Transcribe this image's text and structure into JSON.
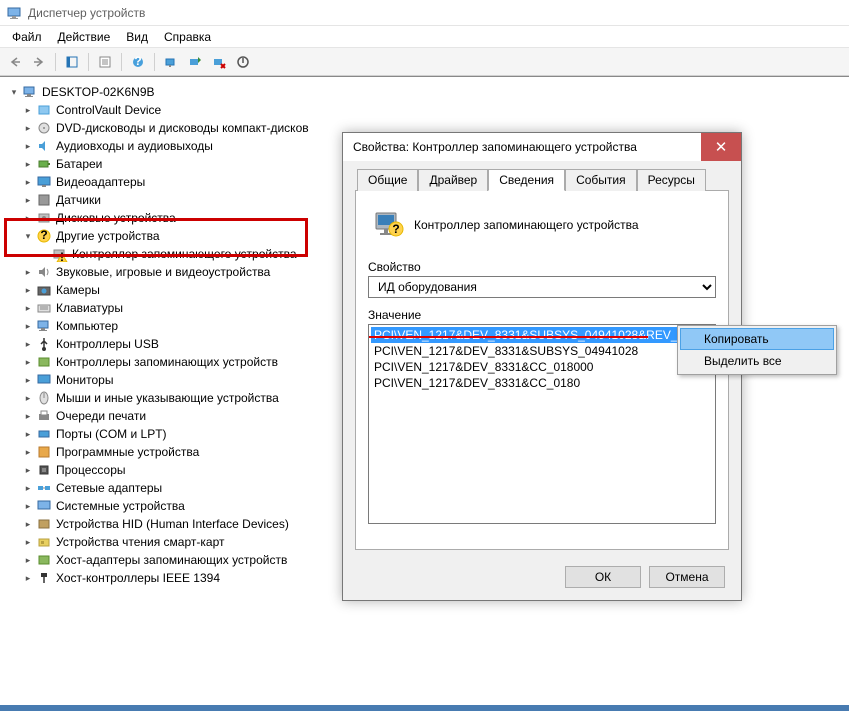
{
  "window": {
    "title": "Диспетчер устройств"
  },
  "menu": {
    "file": "Файл",
    "action": "Действие",
    "view": "Вид",
    "help": "Справка"
  },
  "tree": {
    "root": "DESKTOP-02K6N9B",
    "nodes": [
      {
        "label": "ControlVault Device",
        "icon": "device"
      },
      {
        "label": "DVD-дисководы и дисководы компакт-дисков",
        "icon": "disc"
      },
      {
        "label": "Аудиовходы и аудиовыходы",
        "icon": "audio"
      },
      {
        "label": "Батареи",
        "icon": "battery"
      },
      {
        "label": "Видеоадаптеры",
        "icon": "display"
      },
      {
        "label": "Датчики",
        "icon": "sensor"
      },
      {
        "label": "Дисковые устройства",
        "icon": "disk"
      },
      {
        "label": "Другие устройства",
        "icon": "unknown",
        "expanded": true,
        "children": [
          {
            "label": "Контроллер запоминающего устройства",
            "icon": "warning"
          }
        ]
      },
      {
        "label": "Звуковые, игровые и видеоустройства",
        "icon": "sound"
      },
      {
        "label": "Камеры",
        "icon": "camera"
      },
      {
        "label": "Клавиатуры",
        "icon": "keyboard"
      },
      {
        "label": "Компьютер",
        "icon": "computer"
      },
      {
        "label": "Контроллеры USB",
        "icon": "usb"
      },
      {
        "label": "Контроллеры запоминающих устройств",
        "icon": "storage"
      },
      {
        "label": "Мониторы",
        "icon": "monitor"
      },
      {
        "label": "Мыши и иные указывающие устройства",
        "icon": "mouse"
      },
      {
        "label": "Очереди печати",
        "icon": "printer"
      },
      {
        "label": "Порты (COM и LPT)",
        "icon": "port"
      },
      {
        "label": "Программные устройства",
        "icon": "software"
      },
      {
        "label": "Процессоры",
        "icon": "cpu"
      },
      {
        "label": "Сетевые адаптеры",
        "icon": "network"
      },
      {
        "label": "Системные устройства",
        "icon": "system"
      },
      {
        "label": "Устройства HID (Human Interface Devices)",
        "icon": "hid"
      },
      {
        "label": "Устройства чтения смарт-карт",
        "icon": "smartcard"
      },
      {
        "label": "Хост-адаптеры запоминающих устройств",
        "icon": "host"
      },
      {
        "label": "Хост-контроллеры IEEE 1394",
        "icon": "ieee"
      }
    ]
  },
  "dialog": {
    "title": "Свойства: Контроллер запоминающего устройства",
    "tabs": {
      "general": "Общие",
      "driver": "Драйвер",
      "details": "Сведения",
      "events": "События",
      "resources": "Ресурсы"
    },
    "device_name": "Контроллер запоминающего устройства",
    "property_label": "Свойство",
    "property_value": "ИД оборудования",
    "value_label": "Значение",
    "values": [
      "PCI\\VEN_1217&DEV_8331&SUBSYS_04941028&REV_05",
      "PCI\\VEN_1217&DEV_8331&SUBSYS_04941028",
      "PCI\\VEN_1217&DEV_8331&CC_018000",
      "PCI\\VEN_1217&DEV_8331&CC_0180"
    ],
    "ok": "ОК",
    "cancel": "Отмена"
  },
  "context_menu": {
    "copy": "Копировать",
    "select_all": "Выделить все"
  }
}
